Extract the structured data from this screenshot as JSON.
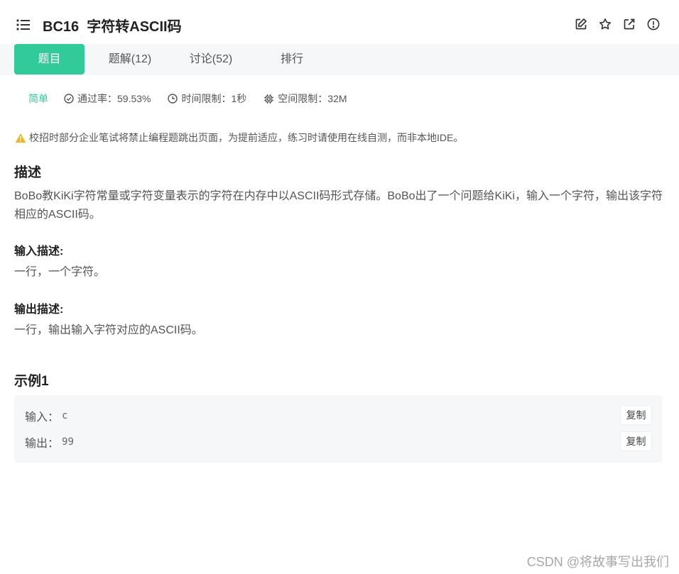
{
  "header": {
    "title": "BC16  字符转ASCII码",
    "icons": [
      "list-icon",
      "edit-icon",
      "star-icon",
      "external-link-icon",
      "info-icon"
    ]
  },
  "tabs": [
    {
      "label": "题目",
      "active": true
    },
    {
      "label": "题解(12)",
      "active": false
    },
    {
      "label": "讨论(52)",
      "active": false
    },
    {
      "label": "排行",
      "active": false
    }
  ],
  "meta": {
    "difficulty": "简单",
    "pass_rate": "通过率：59.53%",
    "time_limit": "时间限制：1秒",
    "space_limit": "空间限制：32M"
  },
  "notice": "校招时部分企业笔试将禁止编程题跳出页面，为提前适应，练习时请使用在线自测，而非本地IDE。",
  "description": {
    "heading": "描述",
    "text": "BoBo教KiKi字符常量或字符变量表示的字符在内存中以ASCII码形式存储。BoBo出了一个问题给KiKi，输入一个字符，输出该字符相应的ASCII码。"
  },
  "input_desc": {
    "heading": "输入描述:",
    "text": "一行，一个字符。"
  },
  "output_desc": {
    "heading": "输出描述:",
    "text": "一行，输出输入字符对应的ASCII码。"
  },
  "example": {
    "heading": "示例1",
    "input_label": "输入：",
    "input_value": "c",
    "output_label": "输出：",
    "output_value": "99",
    "copy_label": "复制"
  },
  "watermark": "CSDN @将故事写出我们",
  "colors": {
    "accent": "#32ca99",
    "warning": "#f5b31b"
  }
}
